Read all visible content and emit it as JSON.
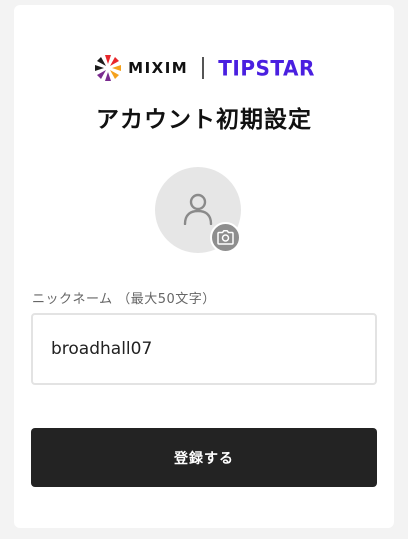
{
  "logos": {
    "mixim_text": "MIXIM",
    "tipstar_text": "TIPSTAR"
  },
  "title": "アカウント初期設定",
  "avatar": {
    "person_icon": "person-icon",
    "camera_icon": "camera-icon"
  },
  "nickname": {
    "label": "ニックネーム （最大50文字）",
    "value": "broadhall07"
  },
  "submit_label": "登録する",
  "colors": {
    "tipstar": "#4a1fe0",
    "button_bg": "#232323",
    "avatar_bg": "#e6e6e6"
  }
}
